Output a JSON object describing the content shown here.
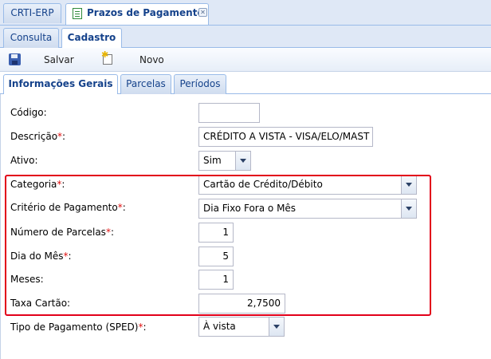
{
  "window_tabs": {
    "erp_label": "CRTI-ERP",
    "active_label": "Prazos de Pagamento"
  },
  "sub_tabs": {
    "consulta": "Consulta",
    "cadastro": "Cadastro"
  },
  "toolbar": {
    "save_label": "Salvar",
    "new_label": "Novo"
  },
  "content_tabs": {
    "info": "Informações Gerais",
    "parcelas": "Parcelas",
    "periodos": "Períodos"
  },
  "form": {
    "codigo": {
      "label": "Código:",
      "value": ""
    },
    "descricao": {
      "label": "Descrição",
      "value": "CRÉDITO A VISTA - VISA/ELO/MAST"
    },
    "ativo": {
      "label": "Ativo:",
      "value": "Sim"
    },
    "categoria": {
      "label": "Categoria",
      "value": "Cartão de Crédito/Débito"
    },
    "criterio": {
      "label": "Critério de Pagamento",
      "value": "Dia Fixo Fora o Mês"
    },
    "num_parcelas": {
      "label": "Número de Parcelas",
      "value": "1"
    },
    "dia_mes": {
      "label": "Dia do Mês",
      "value": "5"
    },
    "meses": {
      "label": "Meses:",
      "value": "1"
    },
    "taxa": {
      "label": "Taxa Cartão:",
      "value": "2,7500"
    },
    "tipo_pagamento": {
      "label": "Tipo de Pagamento (SPED)",
      "value": "À vista"
    },
    "required_mark": "*",
    "colon": ":"
  },
  "colors": {
    "highlight": "#e2001a",
    "required": "#e01010",
    "tab_text": "#15428b"
  }
}
